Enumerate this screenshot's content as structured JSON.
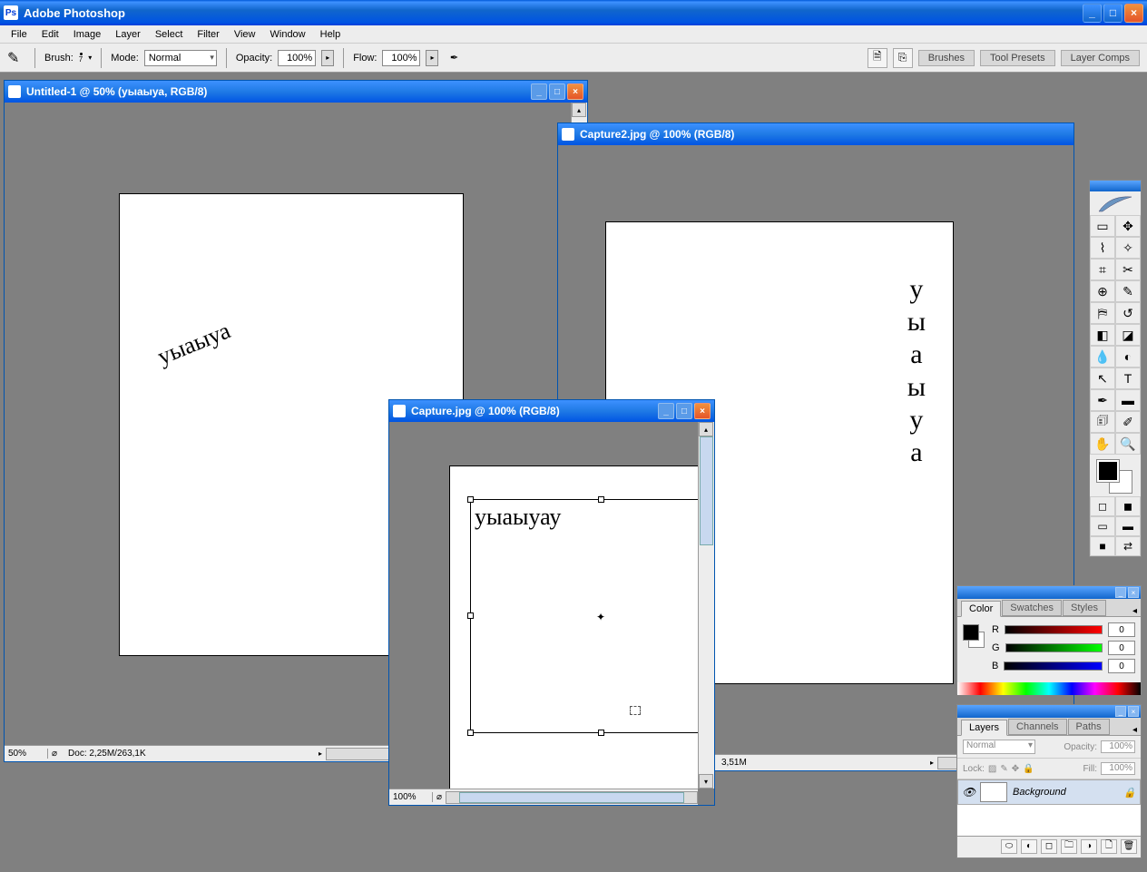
{
  "app": {
    "title": "Adobe Photoshop"
  },
  "menu": {
    "items": [
      "File",
      "Edit",
      "Image",
      "Layer",
      "Select",
      "Filter",
      "View",
      "Window",
      "Help"
    ]
  },
  "options": {
    "brush_label": "Brush:",
    "brush_size": "7",
    "mode_label": "Mode:",
    "mode_value": "Normal",
    "opacity_label": "Opacity:",
    "opacity_value": "100%",
    "flow_label": "Flow:",
    "flow_value": "100%",
    "dock_tabs": [
      "Brushes",
      "Tool Presets",
      "Layer Comps"
    ]
  },
  "doc1": {
    "title": "Untitled-1 @ 50% (уыаыуа, RGB/8)",
    "zoom": "50%",
    "status": "Doc: 2,25M/263,1K",
    "text": "уыаыуа"
  },
  "doc2": {
    "title": "Capture2.jpg @ 100% (RGB/8)",
    "zoom": "100%",
    "status": "3,51M",
    "text": "уыаыуа"
  },
  "doc3": {
    "title": "Capture.jpg @ 100% (RGB/8)",
    "zoom": "100%",
    "text": "уыаыуау"
  },
  "color_panel": {
    "tabs": [
      "Color",
      "Swatches",
      "Styles"
    ],
    "r_label": "R",
    "r_val": "0",
    "g_label": "G",
    "g_val": "0",
    "b_label": "B",
    "b_val": "0"
  },
  "layers_panel": {
    "tabs": [
      "Layers",
      "Channels",
      "Paths"
    ],
    "blend_mode": "Normal",
    "opacity_label": "Opacity:",
    "opacity_val": "100%",
    "lock_label": "Lock:",
    "fill_label": "Fill:",
    "fill_val": "100%",
    "layer_name": "Background"
  }
}
